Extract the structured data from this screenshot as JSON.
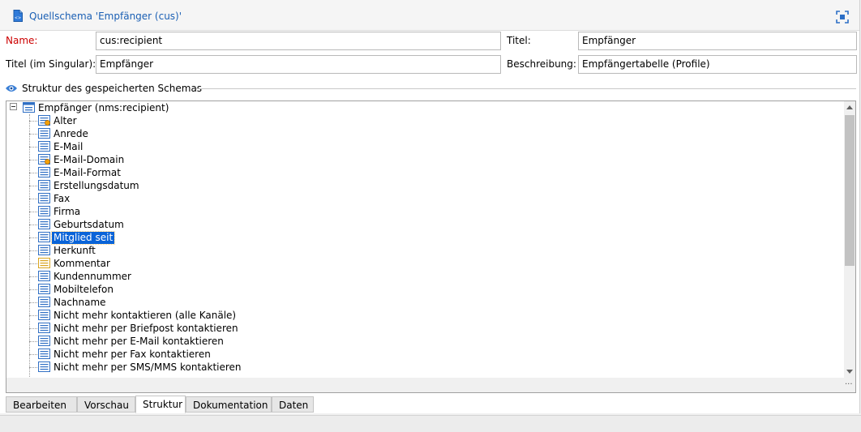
{
  "header": {
    "title": "Quellschema 'Empfänger (cus)'"
  },
  "form": {
    "name_label": "Name:",
    "name_value": "cus:recipient",
    "titel_label": "Titel:",
    "titel_value": "Empfänger",
    "singular_label": "Titel (im Singular):",
    "singular_value": "Empfänger",
    "beschreibung_label": "Beschreibung:",
    "beschreibung_value": "Empfängertabelle (Profile)"
  },
  "structure": {
    "section_title": "Struktur des gespeicherten Schemas",
    "root_label": "Empfänger (nms:recipient)",
    "items": [
      {
        "label": "Alter",
        "icon": "computed-field-icon"
      },
      {
        "label": "Anrede",
        "icon": "field-icon"
      },
      {
        "label": "E-Mail",
        "icon": "field-icon"
      },
      {
        "label": "E-Mail-Domain",
        "icon": "computed-field-icon"
      },
      {
        "label": "E-Mail-Format",
        "icon": "field-icon"
      },
      {
        "label": "Erstellungsdatum",
        "icon": "field-icon"
      },
      {
        "label": "Fax",
        "icon": "field-icon"
      },
      {
        "label": "Firma",
        "icon": "field-icon"
      },
      {
        "label": "Geburtsdatum",
        "icon": "field-icon"
      },
      {
        "label": "Mitglied seit",
        "icon": "field-icon",
        "selected": true
      },
      {
        "label": "Herkunft",
        "icon": "field-icon"
      },
      {
        "label": "Kommentar",
        "icon": "memo-field-icon"
      },
      {
        "label": "Kundennummer",
        "icon": "field-icon"
      },
      {
        "label": "Mobiltelefon",
        "icon": "field-icon"
      },
      {
        "label": "Nachname",
        "icon": "field-icon"
      },
      {
        "label": "Nicht mehr kontaktieren (alle Kanäle)",
        "icon": "field-icon"
      },
      {
        "label": "Nicht mehr per Briefpost kontaktieren",
        "icon": "field-icon"
      },
      {
        "label": "Nicht mehr per E-Mail kontaktieren",
        "icon": "field-icon"
      },
      {
        "label": "Nicht mehr per Fax kontaktieren",
        "icon": "field-icon"
      },
      {
        "label": "Nicht mehr per SMS/MMS kontaktieren",
        "icon": "field-icon"
      }
    ]
  },
  "tabs": [
    {
      "label": "Bearbeiten"
    },
    {
      "label": "Vorschau"
    },
    {
      "label": "Struktur",
      "active": true
    },
    {
      "label": "Dokumentation"
    },
    {
      "label": "Daten"
    }
  ],
  "colors": {
    "title_blue": "#1a5fb4",
    "required_red": "#cc0000",
    "selection": "#0a64d8"
  }
}
